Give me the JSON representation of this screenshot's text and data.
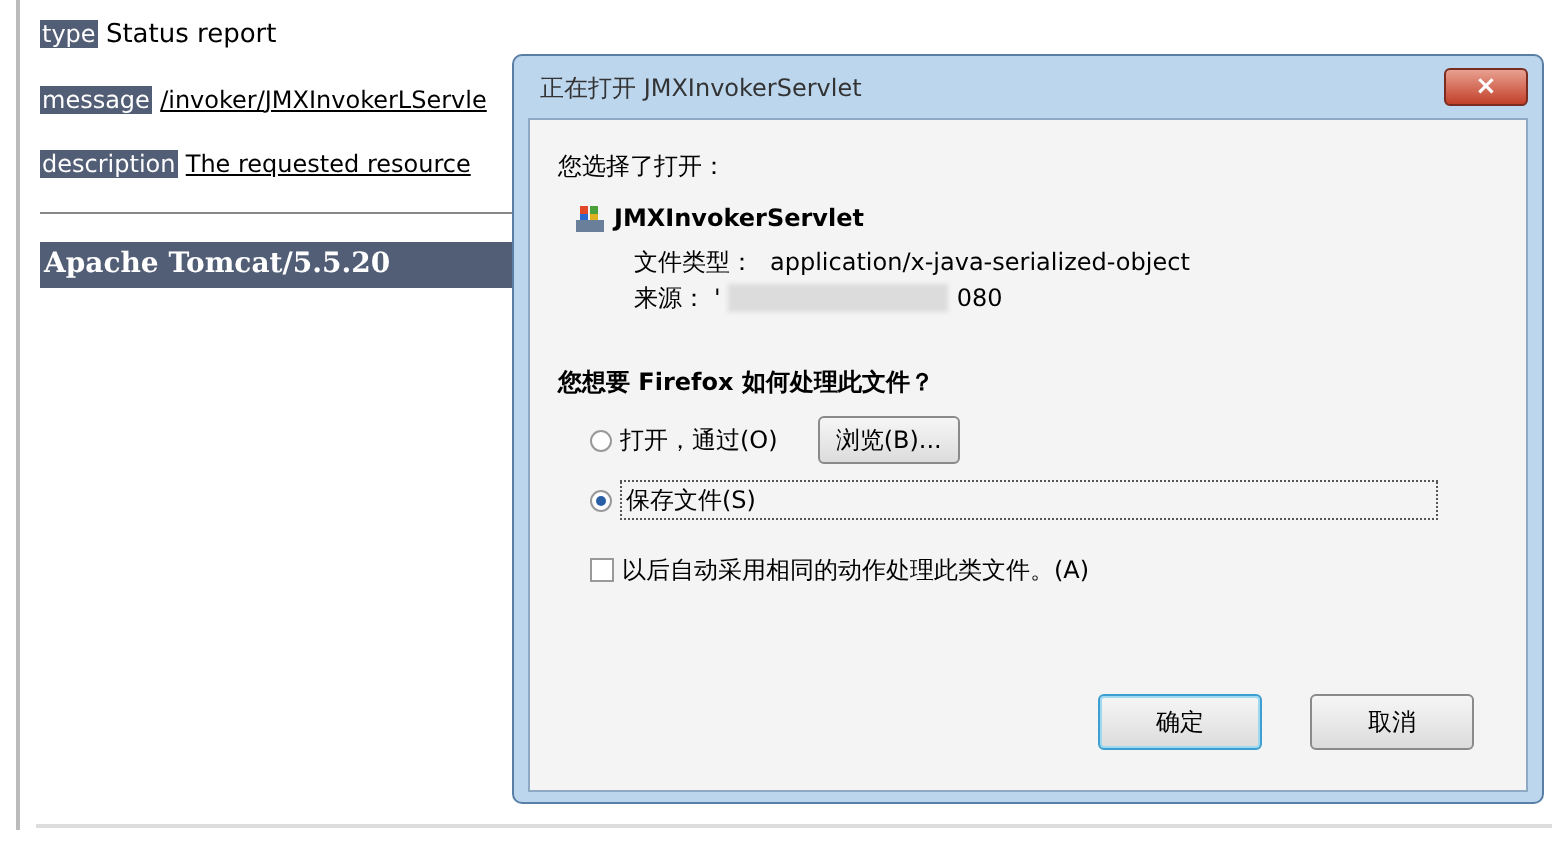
{
  "page": {
    "fields": [
      {
        "label": "type",
        "value": "Status report",
        "link": false
      },
      {
        "label": "message",
        "value": "/invoker/JMXInvokerLServle",
        "link": true
      },
      {
        "label": "description",
        "value": "The requested resource",
        "link": true
      }
    ],
    "footer": "Apache Tomcat/5.5.20"
  },
  "dialog": {
    "title": "正在打开 JMXInvokerServlet",
    "close": "×",
    "intro": "您选择了打开：",
    "file_name": "JMXInvokerServlet",
    "type_label": "文件类型：",
    "type_value": "application/x-java-serialized-object",
    "source_label": "来源：",
    "source_start": "'",
    "source_end": "080",
    "question": "您想要 Firefox 如何处理此文件？",
    "options": [
      {
        "label": "打开，通过(O)",
        "selected": false,
        "focused": false,
        "browse": "浏览(B)..."
      },
      {
        "label": "保存文件(S)",
        "selected": true,
        "focused": true
      }
    ],
    "remember": {
      "label": "以后自动采用相同的动作处理此类文件。(A)",
      "checked": false
    },
    "buttons": [
      {
        "label": "确定",
        "default": true
      },
      {
        "label": "取消",
        "default": false
      }
    ]
  }
}
